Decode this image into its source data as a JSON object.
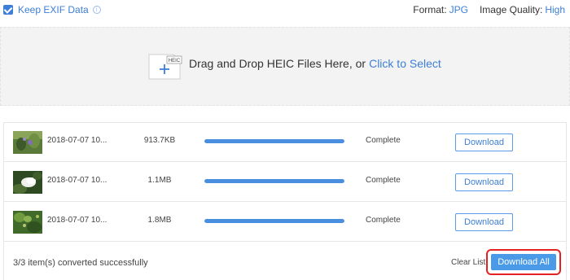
{
  "top": {
    "keep_exif_label": "Keep EXIF Data",
    "info_icon": "i",
    "format_label": "Format:",
    "format_value": "JPG",
    "quality_label": "Image Quality:",
    "quality_value": "High"
  },
  "dropzone": {
    "badge": "HEIC",
    "text": "Drag and Drop HEIC Files Here, or",
    "link": "Click to Select"
  },
  "files": [
    {
      "name": "2018-07-07 10...",
      "size": "913.7KB",
      "progress": 1.0,
      "status": "Complete",
      "button": "Download",
      "thumb": "flower-purple"
    },
    {
      "name": "2018-07-07 10...",
      "size": "1.1MB",
      "progress": 1.0,
      "status": "Complete",
      "button": "Download",
      "thumb": "flower-white"
    },
    {
      "name": "2018-07-07 10...",
      "size": "1.8MB",
      "progress": 1.0,
      "status": "Complete",
      "button": "Download",
      "thumb": "foliage"
    }
  ],
  "footer": {
    "summary": "3/3 item(s) converted successfully",
    "clear_list": "Clear List",
    "download_all": "Download All"
  },
  "colors": {
    "accent": "#3d7fd6",
    "progress": "#4a8ee0",
    "highlight": "#e52222"
  }
}
